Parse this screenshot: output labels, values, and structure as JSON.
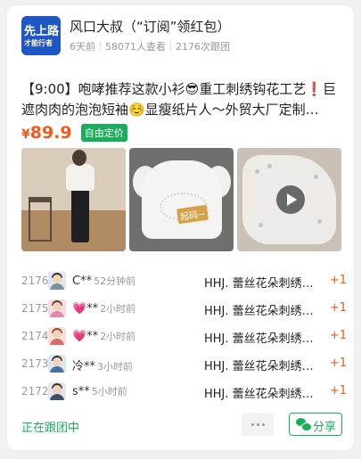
{
  "group": {
    "avatar_line1": "先上路",
    "avatar_line2": "才能行者",
    "title": "风口大叔（“订阅”领红包）",
    "age": "6天前",
    "views": "58071人查看",
    "follows": "2176次跟团"
  },
  "product": {
    "description_line1": "【9:00】咆哮推荐这款小衫😎重工刺绣钩花工艺❗巨",
    "description_line2": "遮肉肉的泡泡短袖☺️显瘦纸片人～外贸大厂定制…",
    "currency": "¥",
    "price": "89.9",
    "price_tag": "自由定价",
    "image2_sticker": "起码~"
  },
  "followers": [
    {
      "num": "2176",
      "name": "C**",
      "time": "52分钟前",
      "item": "HHJ. 蕾丝花朵刺绣…",
      "qty": "+1"
    },
    {
      "num": "2175",
      "name": "💗**",
      "time": "2小时前",
      "item": "HHJ. 蕾丝花朵刺绣…",
      "qty": "+1"
    },
    {
      "num": "2174",
      "name": "💗**",
      "time": "2小时前",
      "item": "HHJ. 蕾丝花朵刺绣…",
      "qty": "+1"
    },
    {
      "num": "2173",
      "name": "冷**",
      "time": "3小时前",
      "item": "HHJ. 蕾丝花朵刺绣…",
      "qty": "+1"
    },
    {
      "num": "2172",
      "name": "s**",
      "time": "5小时前",
      "item": "HHJ. 蕾丝花朵刺绣…",
      "qty": "+1"
    }
  ],
  "footer": {
    "status": "正在跟团中",
    "share_label": "分享"
  },
  "colors": {
    "accent_green": "#1aad5a",
    "price_orange": "#f05a1a"
  }
}
